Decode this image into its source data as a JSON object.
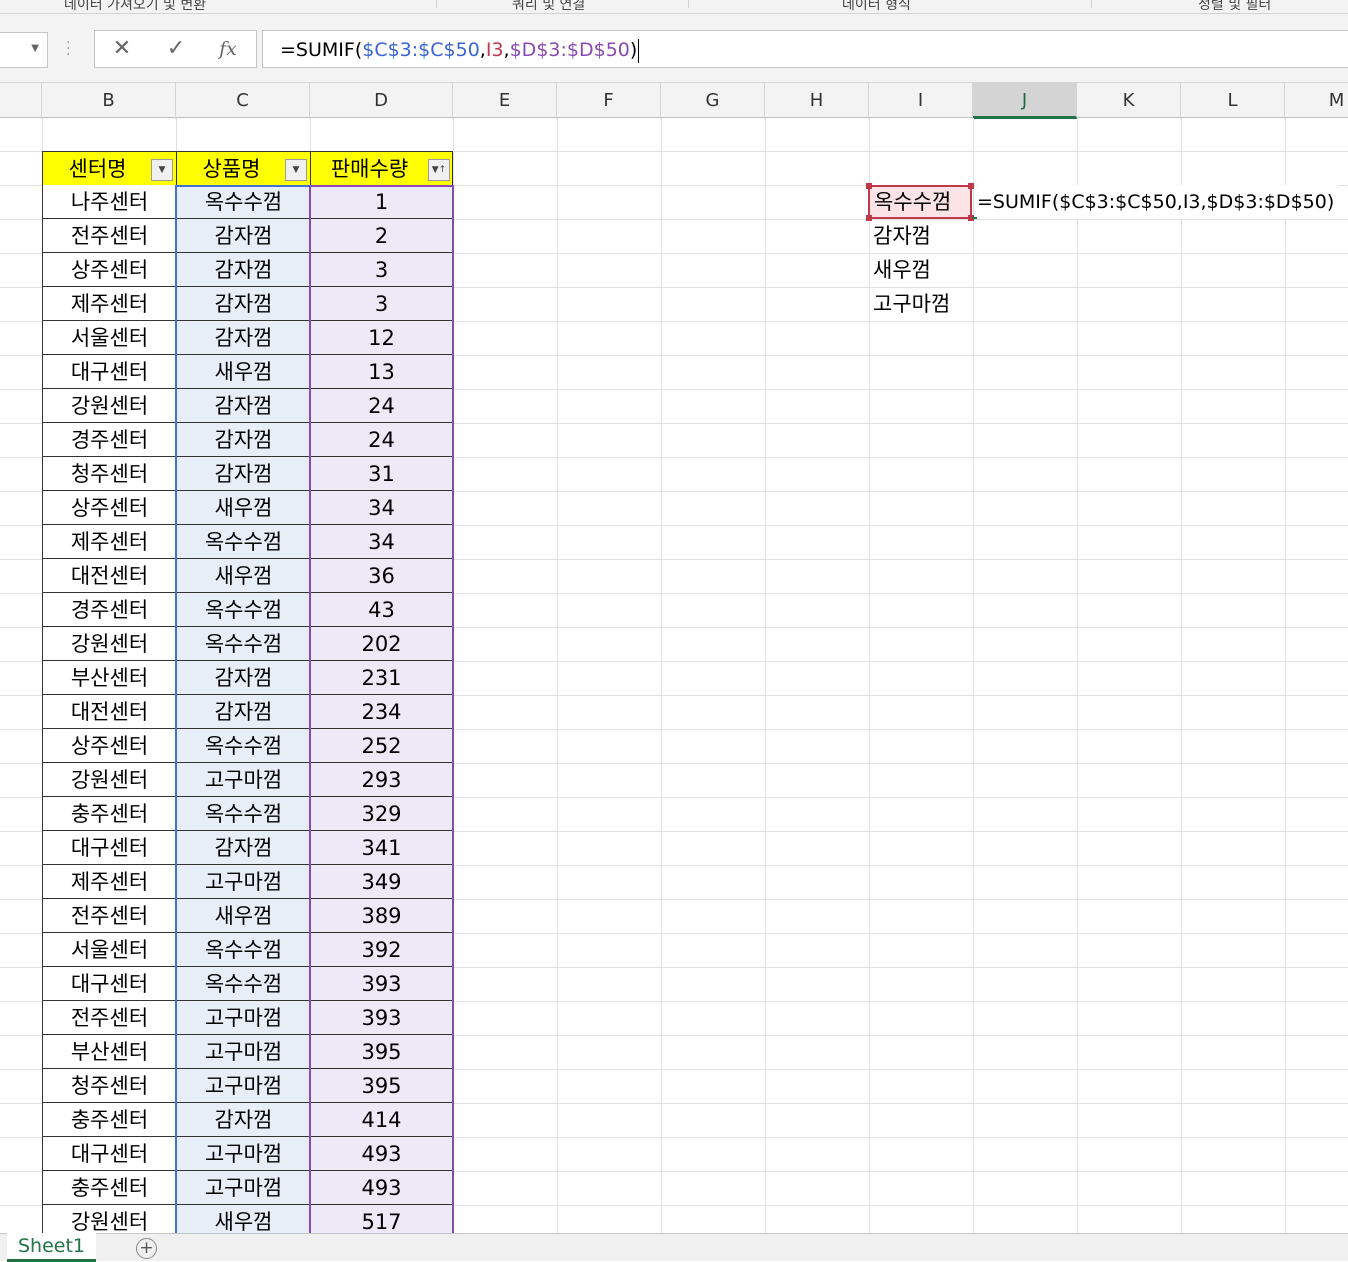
{
  "ribbon_groups": [
    "데이터 가져오기 및 변환",
    "쿼리 및 연결",
    "데이터 형식",
    "정렬 및 필터"
  ],
  "formula_bar": {
    "namebox_value": "",
    "cancel_icon": "✕",
    "enter_icon": "✓",
    "fx_label": "fx",
    "formula_parts": [
      "=SUMIF(",
      "$C$3:$C$50",
      ",",
      "I3",
      ",",
      "$D$3:$D$50",
      ")"
    ]
  },
  "columns": [
    "B",
    "C",
    "D",
    "E",
    "F",
    "G",
    "H",
    "I",
    "J",
    "K",
    "L",
    "M"
  ],
  "selected_column": "J",
  "table": {
    "headers": [
      "센터명",
      "상품명",
      "판매수량"
    ],
    "rows": [
      [
        "나주센터",
        "옥수수껌",
        "1"
      ],
      [
        "전주센터",
        "감자껌",
        "2"
      ],
      [
        "상주센터",
        "감자껌",
        "3"
      ],
      [
        "제주센터",
        "감자껌",
        "3"
      ],
      [
        "서울센터",
        "감자껌",
        "12"
      ],
      [
        "대구센터",
        "새우껌",
        "13"
      ],
      [
        "강원센터",
        "감자껌",
        "24"
      ],
      [
        "경주센터",
        "감자껌",
        "24"
      ],
      [
        "청주센터",
        "감자껌",
        "31"
      ],
      [
        "상주센터",
        "새우껌",
        "34"
      ],
      [
        "제주센터",
        "옥수수껌",
        "34"
      ],
      [
        "대전센터",
        "새우껌",
        "36"
      ],
      [
        "경주센터",
        "옥수수껌",
        "43"
      ],
      [
        "강원센터",
        "옥수수껌",
        "202"
      ],
      [
        "부산센터",
        "감자껌",
        "231"
      ],
      [
        "대전센터",
        "감자껌",
        "234"
      ],
      [
        "상주센터",
        "옥수수껌",
        "252"
      ],
      [
        "강원센터",
        "고구마껌",
        "293"
      ],
      [
        "충주센터",
        "옥수수껌",
        "329"
      ],
      [
        "대구센터",
        "감자껌",
        "341"
      ],
      [
        "제주센터",
        "고구마껌",
        "349"
      ],
      [
        "전주센터",
        "새우껌",
        "389"
      ],
      [
        "서울센터",
        "옥수수껌",
        "392"
      ],
      [
        "대구센터",
        "옥수수껌",
        "393"
      ],
      [
        "전주센터",
        "고구마껌",
        "393"
      ],
      [
        "부산센터",
        "고구마껌",
        "395"
      ],
      [
        "청주센터",
        "고구마껌",
        "395"
      ],
      [
        "충주센터",
        "감자껌",
        "414"
      ],
      [
        "대구센터",
        "고구마껌",
        "493"
      ],
      [
        "충주센터",
        "고구마껌",
        "493"
      ],
      [
        "강원센터",
        "새우껌",
        "517"
      ]
    ]
  },
  "lookup_list": [
    "옥수수껌",
    "감자껌",
    "새우껌",
    "고구마껌"
  ],
  "active_cell_text": "=SUMIF($C$3:$C$50,I3,$D$3:$D$50)",
  "sheet_tabs": [
    "Sheet1"
  ],
  "add_sheet_icon": "+",
  "colors": {
    "header_fill": "#ffff00",
    "range_c": "#3f73d8",
    "range_i": "#c0394b",
    "range_d": "#8b49b5",
    "accent": "#217346"
  }
}
